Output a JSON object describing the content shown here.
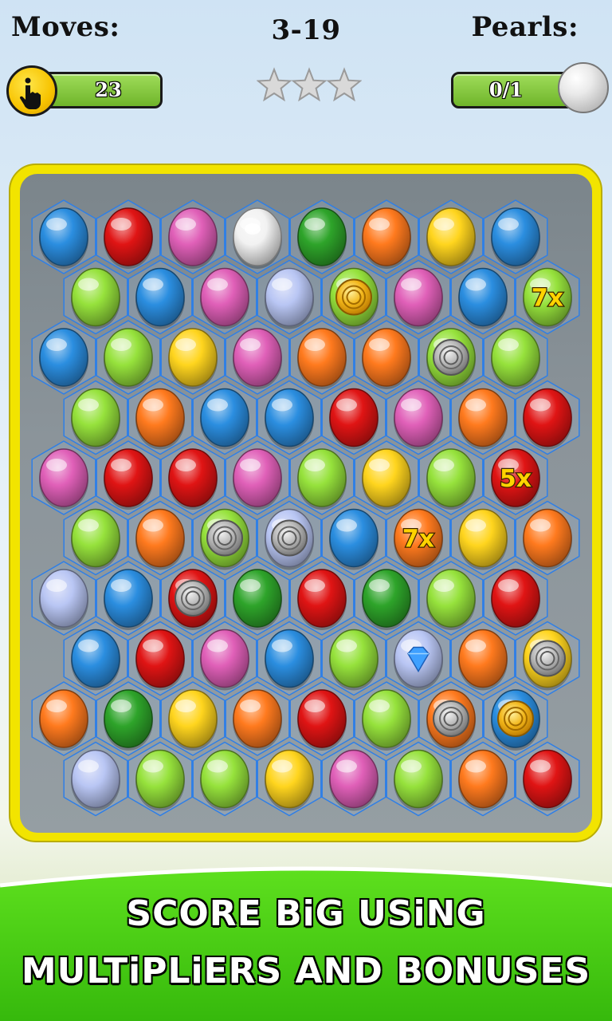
{
  "hud": {
    "moves_label": "Moves:",
    "level": "3-19",
    "pearls_label": "Pearls:",
    "moves_value": "23",
    "pearls_value": "0/1",
    "stars_earned": 0,
    "stars_total": 3
  },
  "colors": {
    "blue": "#2b8ee0",
    "red": "#e01414",
    "pink": "#e060b8",
    "green": "#96e23c",
    "dkgreen": "#2ea42a",
    "orange": "#ff7a1e",
    "yellow": "#ffd51e",
    "lavender": "#b9c6f4",
    "white": "#f2f2f2"
  },
  "board": {
    "rows": [
      [
        {
          "c": "blue"
        },
        {
          "c": "red"
        },
        {
          "c": "pink"
        },
        {
          "c": "white",
          "p": "pearl"
        },
        {
          "c": "dkgreen"
        },
        {
          "c": "orange"
        },
        {
          "c": "yellow"
        },
        {
          "c": "blue"
        }
      ],
      [
        {
          "c": "green"
        },
        {
          "c": "blue"
        },
        {
          "c": "pink"
        },
        {
          "c": "lavender"
        },
        {
          "c": "green",
          "p": "gold-coin"
        },
        {
          "c": "pink"
        },
        {
          "c": "blue"
        },
        {
          "c": "green",
          "p": "multiplier",
          "m": "7x"
        }
      ],
      [
        {
          "c": "blue"
        },
        {
          "c": "green"
        },
        {
          "c": "yellow"
        },
        {
          "c": "pink"
        },
        {
          "c": "orange"
        },
        {
          "c": "orange"
        },
        {
          "c": "green",
          "p": "silver-coin"
        },
        {
          "c": "green"
        }
      ],
      [
        {
          "c": "green"
        },
        {
          "c": "orange"
        },
        {
          "c": "blue"
        },
        {
          "c": "blue"
        },
        {
          "c": "red"
        },
        {
          "c": "pink"
        },
        {
          "c": "orange"
        },
        {
          "c": "red"
        }
      ],
      [
        {
          "c": "pink"
        },
        {
          "c": "red"
        },
        {
          "c": "red"
        },
        {
          "c": "pink"
        },
        {
          "c": "green"
        },
        {
          "c": "yellow"
        },
        {
          "c": "green"
        },
        {
          "c": "red",
          "p": "multiplier",
          "m": "5x"
        }
      ],
      [
        {
          "c": "green"
        },
        {
          "c": "orange"
        },
        {
          "c": "green",
          "p": "silver-coin"
        },
        {
          "c": "lavender",
          "p": "silver-coin"
        },
        {
          "c": "blue"
        },
        {
          "c": "orange",
          "p": "multiplier",
          "m": "7x"
        },
        {
          "c": "yellow"
        },
        {
          "c": "orange"
        }
      ],
      [
        {
          "c": "lavender"
        },
        {
          "c": "blue"
        },
        {
          "c": "red",
          "p": "silver-coin"
        },
        {
          "c": "dkgreen"
        },
        {
          "c": "red"
        },
        {
          "c": "dkgreen"
        },
        {
          "c": "green"
        },
        {
          "c": "red"
        }
      ],
      [
        {
          "c": "blue"
        },
        {
          "c": "red"
        },
        {
          "c": "pink"
        },
        {
          "c": "blue"
        },
        {
          "c": "green"
        },
        {
          "c": "lavender",
          "p": "diamond"
        },
        {
          "c": "orange"
        },
        {
          "c": "yellow",
          "p": "silver-coin"
        }
      ],
      [
        {
          "c": "orange"
        },
        {
          "c": "dkgreen"
        },
        {
          "c": "yellow"
        },
        {
          "c": "orange"
        },
        {
          "c": "red"
        },
        {
          "c": "green"
        },
        {
          "c": "orange",
          "p": "silver-coin"
        },
        {
          "c": "blue",
          "p": "gold-coin"
        }
      ],
      [
        {
          "c": "lavender"
        },
        {
          "c": "green"
        },
        {
          "c": "green"
        },
        {
          "c": "yellow"
        },
        {
          "c": "pink"
        },
        {
          "c": "green"
        },
        {
          "c": "orange"
        },
        {
          "c": "red"
        }
      ]
    ]
  },
  "slogan": {
    "line1": "SCORE BiG USiNG",
    "line2": "MULTiPLiERS AND BONUSES"
  }
}
